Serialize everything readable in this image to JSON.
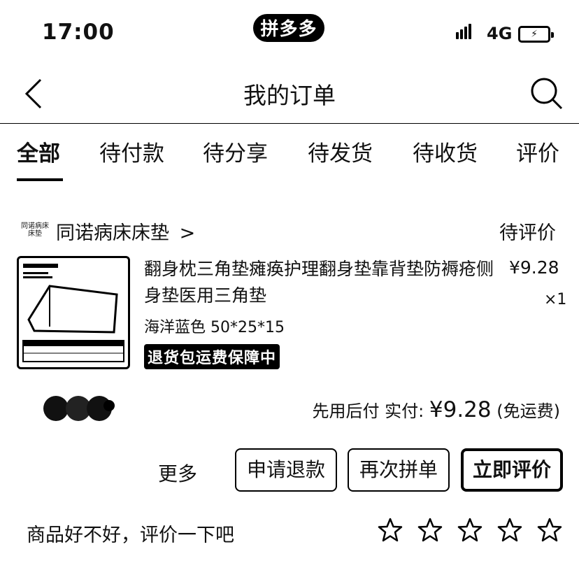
{
  "status_bar": {
    "time": "17:00",
    "app_logo": "拼多多",
    "network": "4G",
    "battery_icon": "battery-charging-icon"
  },
  "header": {
    "title": "我的订单",
    "back_icon": "back-chevron-icon",
    "search_icon": "search-icon"
  },
  "tabs": [
    {
      "label": "全部",
      "active": true
    },
    {
      "label": "待付款"
    },
    {
      "label": "待分享"
    },
    {
      "label": "待发货"
    },
    {
      "label": "待收货"
    },
    {
      "label": "评价"
    }
  ],
  "order": {
    "shop": {
      "icon_text": "同诺病床床垫",
      "name": "同诺病床床垫",
      "chevron": ">"
    },
    "status": "待评价",
    "product": {
      "title": "翻身枕三角垫瘫痪护理翻身垫靠背垫防褥疮侧身垫医用三角垫",
      "price": "¥9.28",
      "quantity": "×1",
      "variant": "海洋蓝色 50*25*15",
      "badge": "退货包运费保障中"
    },
    "payment": {
      "prefix": "先用后付 实付:",
      "amount": "¥9.28",
      "suffix": "(免运费)"
    },
    "actions": {
      "more": "更多",
      "refund": "申请退款",
      "rebuy": "再次拼单",
      "review": "立即评价"
    }
  },
  "rating": {
    "prompt": "商品好不好，评价一下吧",
    "stars": 5
  }
}
